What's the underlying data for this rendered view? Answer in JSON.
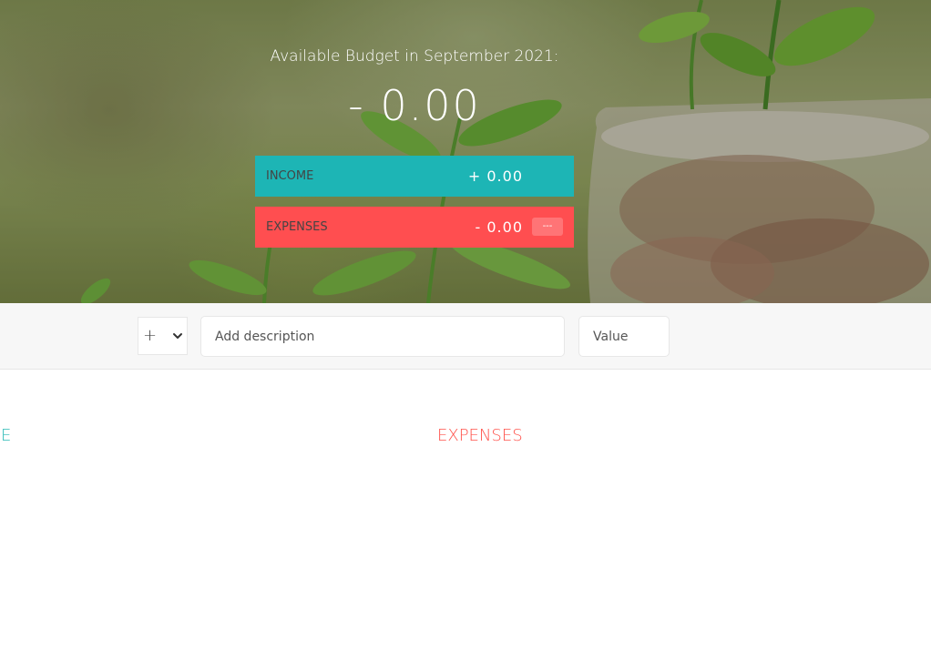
{
  "budget": {
    "title": "Available Budget in September 2021:",
    "value": "- 0.00",
    "income": {
      "label": "Income",
      "value": "+ 0.00"
    },
    "expenses": {
      "label": "Expenses",
      "value": "- 0.00",
      "percentage": "---"
    }
  },
  "add": {
    "type_selected": "+",
    "description_placeholder": "Add description",
    "value_placeholder": "Value"
  },
  "lists": {
    "income_title": "Income",
    "expenses_title": "Expenses"
  },
  "colors": {
    "income_accent": "#28b9b5",
    "expenses_accent": "#ff5049",
    "income_bar": "#1db5b5",
    "expenses_bar": "#ff4e50"
  }
}
